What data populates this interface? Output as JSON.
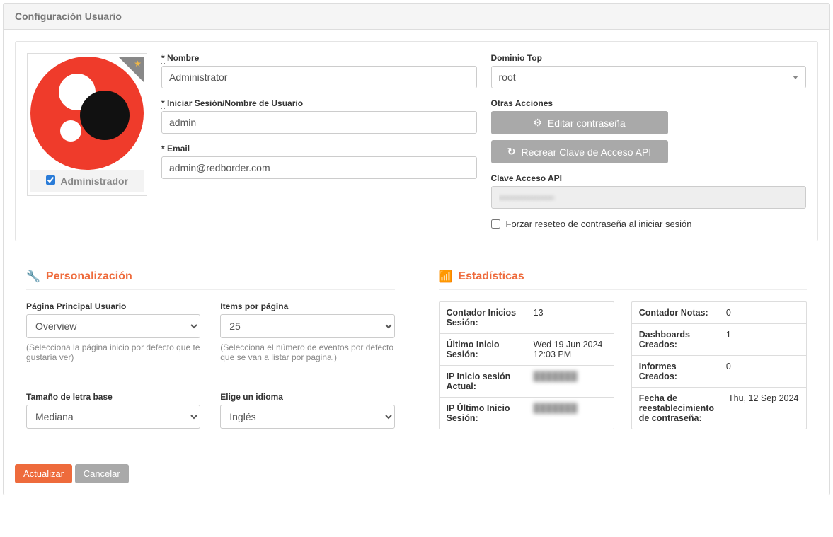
{
  "header": {
    "title": "Configuración Usuario"
  },
  "avatar": {
    "admin_label": "Administrador",
    "admin_checked": true
  },
  "fields": {
    "name": {
      "label": "Nombre",
      "value": "Administrator",
      "required": true
    },
    "login": {
      "label": "Iniciar Sesión/Nombre de Usuario",
      "value": "admin",
      "required": true
    },
    "email": {
      "label": "Email",
      "value": "admin@redborder.com",
      "required": true
    },
    "top_domain": {
      "label": "Dominio Top",
      "value": "root"
    },
    "other_actions_label": "Otras Acciones",
    "edit_password_btn": "Editar contraseña",
    "recreate_api_btn": "Recrear Clave de Acceso API",
    "api_key": {
      "label": "Clave Acceso API",
      "value": "••••••••••••••••"
    },
    "force_reset": {
      "label": "Forzar reseteo de contraseña al iniciar sesión",
      "checked": false
    }
  },
  "personalization": {
    "title": "Personalización",
    "home_page": {
      "label": "Página Principal Usuario",
      "value": "Overview",
      "hint": "(Selecciona la página inicio por defecto que te gustaría ver)"
    },
    "items_per_page": {
      "label": "Items por página",
      "value": "25",
      "hint": "(Selecciona el número de eventos por defecto que se van a listar por pagina.)"
    },
    "font_size": {
      "label": "Tamaño de letra base",
      "value": "Mediana"
    },
    "language": {
      "label": "Elige un idioma",
      "value": "Inglés"
    }
  },
  "stats": {
    "title": "Estadísticas",
    "left": [
      {
        "k": "Contador Inicios Sesión:",
        "v": "13"
      },
      {
        "k": "Último Inicio Sesión:",
        "v": "Wed 19 Jun 2024 12:03 PM"
      },
      {
        "k": "IP Inicio sesión Actual:",
        "v": "███████",
        "blurred": true
      },
      {
        "k": "IP Último Inicio Sesión:",
        "v": "███████",
        "blurred": true
      }
    ],
    "right": [
      {
        "k": "Contador Notas:",
        "v": "0"
      },
      {
        "k": "Dashboards Creados:",
        "v": "1"
      },
      {
        "k": "Informes Creados:",
        "v": "0"
      },
      {
        "k": "Fecha de reestablecimiento de contraseña:",
        "v": "Thu, 12 Sep 2024"
      }
    ]
  },
  "footer": {
    "update": "Actualizar",
    "cancel": "Cancelar"
  }
}
